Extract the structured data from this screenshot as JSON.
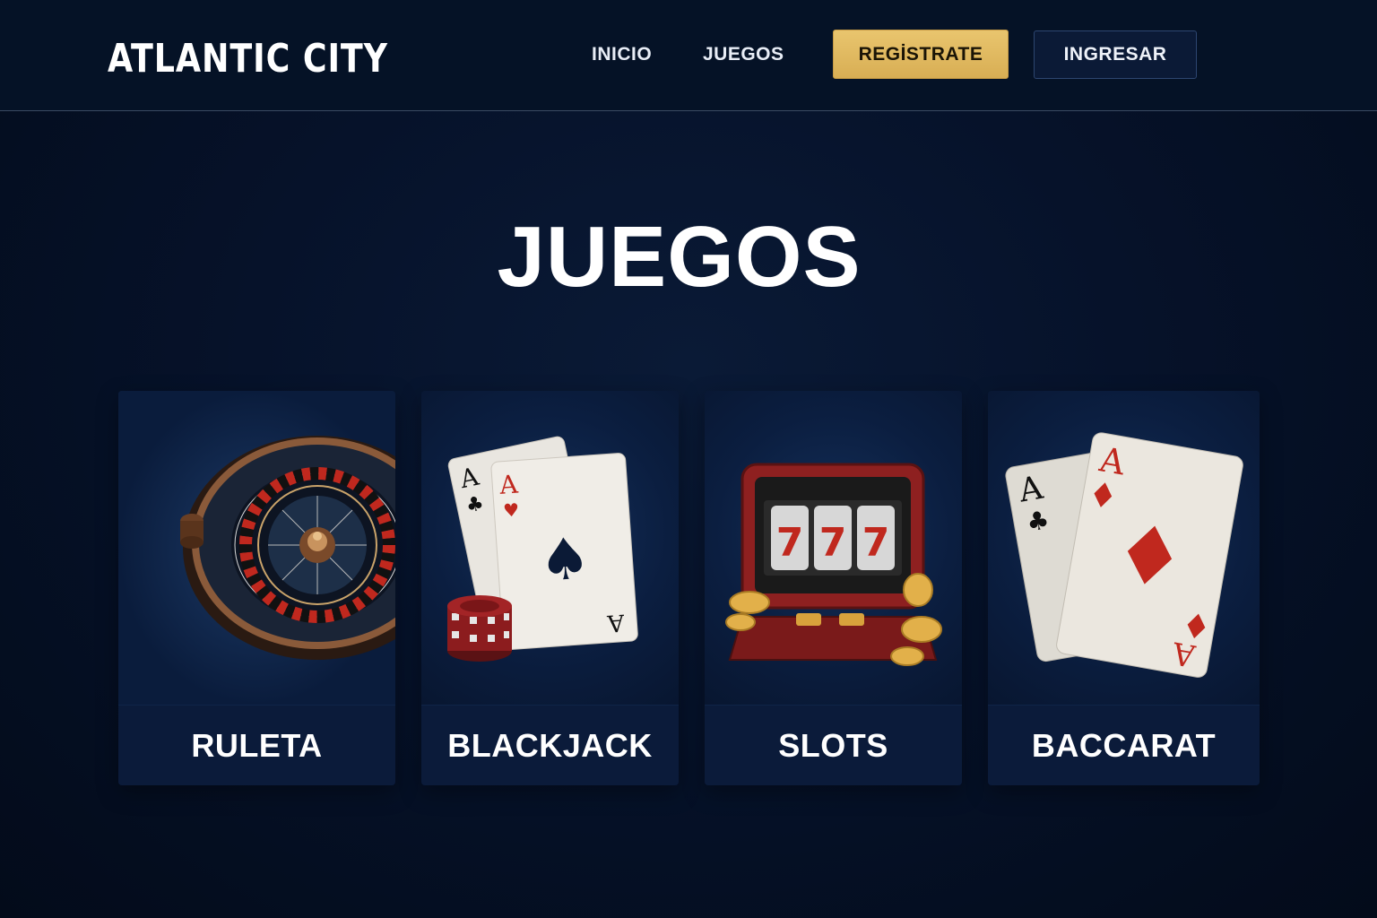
{
  "header": {
    "brand": "ATLANTIC CITY",
    "nav": [
      {
        "label": "INICIO"
      },
      {
        "label": "JUEGOS"
      }
    ],
    "register_label": "REGİSTRATE",
    "login_label": "INGRESAR"
  },
  "main": {
    "title": "JUEGOS",
    "games": [
      {
        "label": "RULETA",
        "icon": "roulette-wheel-icon"
      },
      {
        "label": "BLACKJACK",
        "icon": "playing-cards-chips-icon"
      },
      {
        "label": "SLOTS",
        "icon": "slot-machine-icon"
      },
      {
        "label": "BACCARAT",
        "icon": "ace-cards-icon"
      }
    ],
    "card_text": {
      "ace": "A",
      "sevens": [
        "7",
        "7",
        "7"
      ]
    }
  },
  "colors": {
    "background": "#040e20",
    "header": "#051226",
    "accent_gold": "#e2bb62",
    "card": "#0a1a38",
    "red": "#c0281e"
  }
}
